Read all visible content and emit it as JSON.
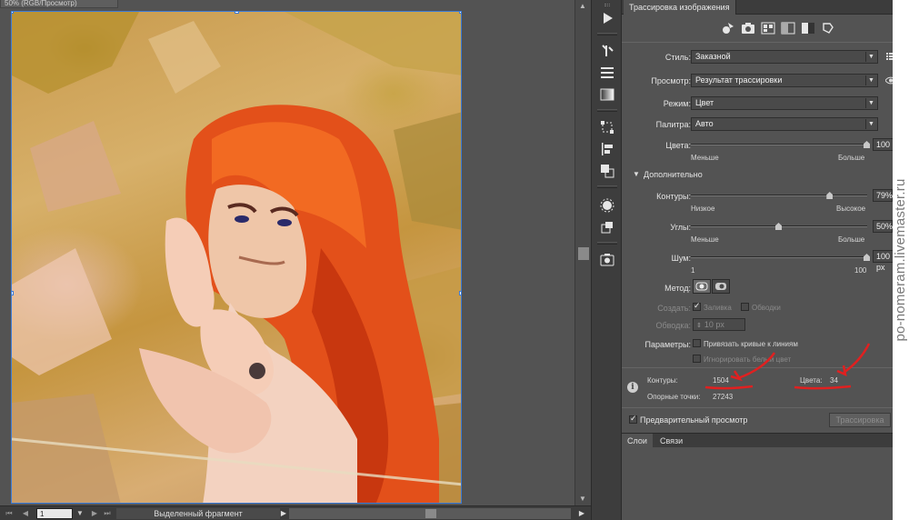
{
  "document": {
    "tab_title": "50% (RGB/Просмотр)",
    "zoom": "1",
    "selection_label": "Выделенный фрагмент"
  },
  "panel": {
    "title": "Трассировка изображения",
    "style": {
      "label": "Стиль:",
      "value": "Заказной"
    },
    "view": {
      "label": "Просмотр:",
      "value": "Результат трассировки"
    },
    "mode": {
      "label": "Режим:",
      "value": "Цвет"
    },
    "palette": {
      "label": "Палитра:",
      "value": "Авто"
    },
    "colors": {
      "label": "Цвета:",
      "value": "100",
      "level": 1.0,
      "min_label": "Меньше",
      "max_label": "Больше"
    },
    "advanced": {
      "label": "Дополнительно"
    },
    "paths": {
      "label": "Контуры:",
      "value": "79%",
      "level": 0.79,
      "min_label": "Низкое",
      "max_label": "Высокое"
    },
    "corners": {
      "label": "Углы:",
      "value": "50%",
      "level": 0.5,
      "min_label": "Меньше",
      "max_label": "Больше"
    },
    "noise": {
      "label": "Шум:",
      "value": "100 px",
      "level": 1.0,
      "min_label": "1",
      "max_label": "100"
    },
    "method": {
      "label": "Метод:"
    },
    "create": {
      "label": "Создать:",
      "fill": "Заливка",
      "stroke": "Обводки"
    },
    "stroke": {
      "label": "Обводка:",
      "value": "10 px"
    },
    "options": {
      "label": "Параметры:",
      "snap": "Привязать кривые к линиям",
      "ignore_white": "Игнорировать белый цвет"
    },
    "stats": {
      "paths_label": "Контуры:",
      "paths_value": "1504",
      "colors_label": "Цвета:",
      "colors_value": "34",
      "anchors_label": "Опорные точки:",
      "anchors_value": "27243"
    },
    "preview_label": "Предварительный просмотр",
    "trace_button": "Трассировка"
  },
  "layers_panel": {
    "tab_layers": "Слои",
    "tab_links": "Связи"
  },
  "watermark": "po-nomeram.livemaster.ru",
  "colors": {
    "annotation_red": "#e02020",
    "panel_bg": "#535353",
    "selection_blue": "#3b7bd8"
  }
}
